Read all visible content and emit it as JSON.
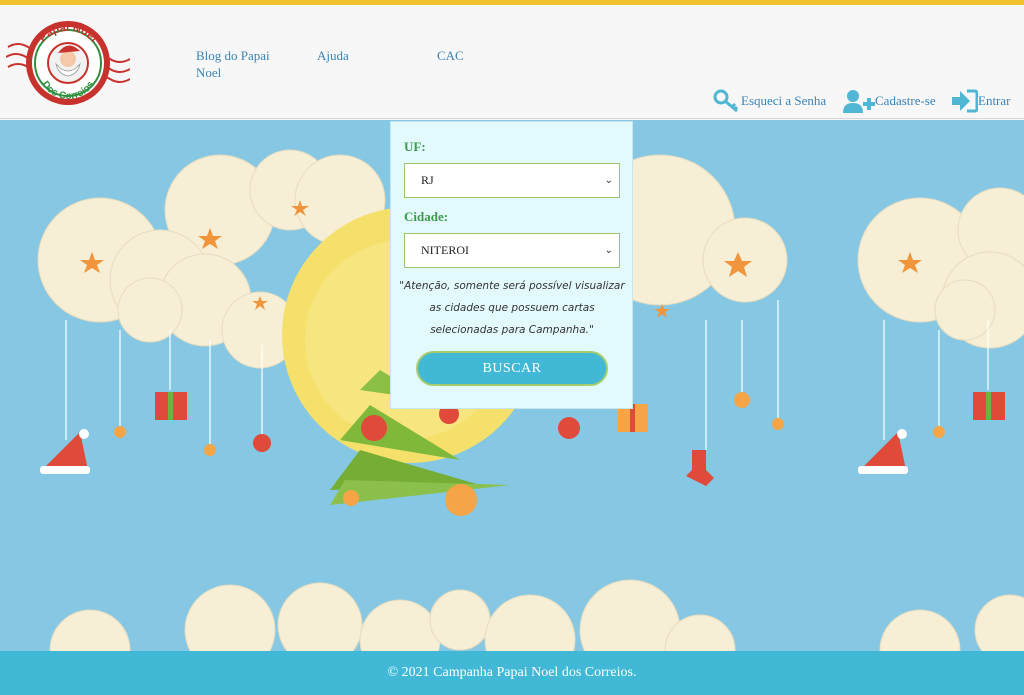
{
  "brand": {
    "logo_text_top": "Papai Noel",
    "logo_text_bottom": "Dos Correios"
  },
  "nav": {
    "blog_label": "Blog do Papai Noel",
    "ajuda_label": "Ajuda",
    "cac_label": "CAC"
  },
  "actions": {
    "forgot_label": "Esqueci a Senha",
    "forgot_icon": "key-icon",
    "register_label": "Cadastre-se",
    "register_icon": "add-user-icon",
    "login_label": "Entrar",
    "login_icon": "sign-in-icon"
  },
  "search": {
    "uf_label": "UF:",
    "uf_value": "RJ",
    "cidade_label": "Cidade:",
    "cidade_value": "NITEROI",
    "notice": "\"Atenção, somente será possível visualizar as cidades que possuem cartas selecionadas para Campanha.\"",
    "button_label": "BUSCAR"
  },
  "footer": {
    "copyright": "© 2021 Campanha Papai Noel dos Correios."
  },
  "colors": {
    "top_stripe": "#f2c230",
    "link": "#3b83b5",
    "sky": "#86c8e3",
    "footer_bg": "#41b8d5",
    "label_green": "#3c9c49",
    "button_bg": "#41b8d5"
  }
}
